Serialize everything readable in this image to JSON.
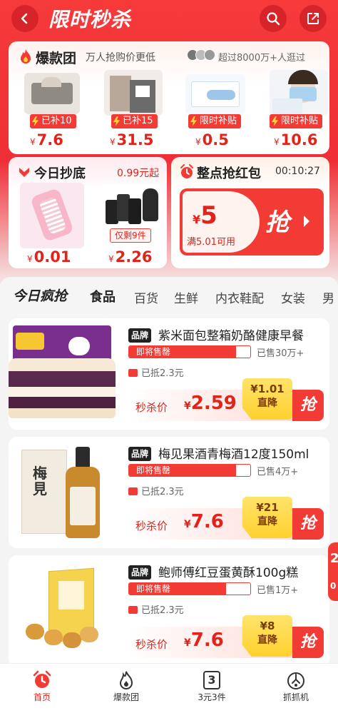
{
  "header": {
    "title": "限时秒杀"
  },
  "hot": {
    "title": "爆款团",
    "subtitle": "万人抢购价更低",
    "visitors": "超过8000万+人逛过",
    "items": [
      {
        "badge": "已补10",
        "price_symbol": "¥",
        "price": "7.6"
      },
      {
        "badge": "已补15",
        "price_symbol": "¥",
        "price": "31.5"
      },
      {
        "badge": "限时补贴",
        "price_symbol": "¥",
        "price": "0.5"
      },
      {
        "badge": "限时补贴",
        "price_symbol": "¥",
        "price": "10.6"
      }
    ]
  },
  "bottom_deal": {
    "title": "今日抄底",
    "tag": "0.99元起",
    "items": [
      {
        "price_symbol": "¥",
        "price": "0.01"
      },
      {
        "stock": "仅剩9件",
        "price_symbol": "¥",
        "price": "2.26"
      }
    ]
  },
  "red_packet": {
    "title": "整点抢红包",
    "countdown": "00:10:27",
    "amount_symbol": "¥",
    "amount": "5",
    "condition": "满5.01可用",
    "grab": "抢"
  },
  "tabs": [
    "今日疯抢",
    "食品",
    "百货",
    "生鲜",
    "内衣鞋配",
    "女装",
    "男"
  ],
  "products": [
    {
      "brand": "品牌",
      "name": "紫米面包整箱奶酪健康早餐",
      "status": "即将售罄",
      "sold": "已售30万+",
      "progress": 0.88,
      "subsidy": "已抵2.3元",
      "deal_label": "秒杀价",
      "price_symbol": "¥",
      "price": "2.59",
      "drop_amount": "¥1.01",
      "drop_label": "直降",
      "grab": "抢"
    },
    {
      "brand": "品牌",
      "name": "梅见果酒青梅酒12度150ml",
      "status": "即将售罄",
      "sold": "已售4万+",
      "progress": 0.88,
      "subsidy": "已抵2.3元",
      "deal_label": "秒杀价",
      "price_symbol": "¥",
      "price": "7.6",
      "drop_amount": "¥21",
      "drop_label": "直降",
      "grab": "抢"
    },
    {
      "brand": "品牌",
      "name": "鲍师傅红豆蛋黄酥100g糕",
      "status": "即将售罄",
      "sold": "已售1万+",
      "progress": 0.8,
      "subsidy": "已抵2.3元",
      "deal_label": "秒杀价",
      "price_symbol": "¥",
      "price": "7.6",
      "drop_amount": "¥8",
      "drop_label": "直降",
      "grab": "抢"
    }
  ],
  "float_tag": {
    "top": "2",
    "bottom": "0"
  },
  "nav": [
    {
      "label": "首页",
      "icon": "alarm-clock-icon",
      "active": true
    },
    {
      "label": "爆款团",
      "icon": "flame-icon"
    },
    {
      "label": "3元3件",
      "icon": "number-3-icon",
      "glyph": "3"
    },
    {
      "label": "抓抓机",
      "icon": "claw-machine-icon"
    }
  ],
  "colors": {
    "accent": "#f23b35",
    "price": "#e2231a",
    "drop_yellow": "#ffd12e"
  }
}
